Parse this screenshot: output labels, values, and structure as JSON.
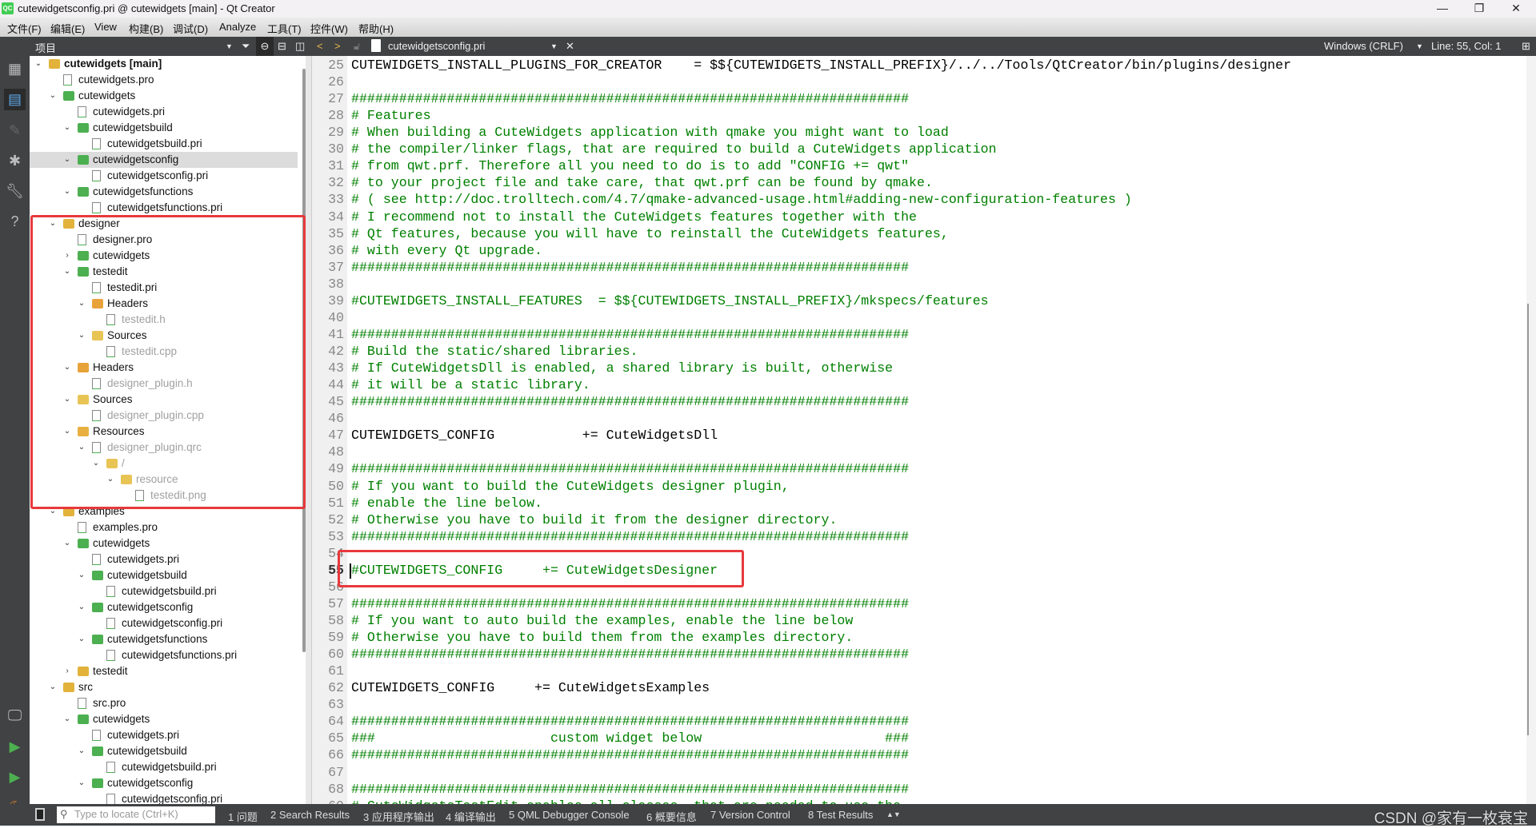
{
  "window": {
    "title": "cutewidgetsconfig.pri @ cutewidgets [main] - Qt Creator",
    "logo": "QC"
  },
  "menu": [
    "文件(F)",
    "编辑(E)",
    "View",
    "构建(B)",
    "调试(D)",
    "Analyze",
    "工具(T)",
    "控件(W)",
    "帮助(H)"
  ],
  "toolbar": {
    "panel_title": "项目",
    "file_name": "cutewidgetsconfig.pri",
    "line_ending": "Windows (CRLF)",
    "cursor_pos": "Line: 55, Col: 1"
  },
  "tree": [
    {
      "label": "cutewidgets [main]",
      "level": 0,
      "kind": "project",
      "exp": true,
      "bold": true
    },
    {
      "label": "cutewidgets.pro",
      "level": 1,
      "kind": "file"
    },
    {
      "label": "cutewidgets",
      "level": 1,
      "kind": "pfolder",
      "exp": true
    },
    {
      "label": "cutewidgets.pri",
      "level": 2,
      "kind": "file"
    },
    {
      "label": "cutewidgetsbuild",
      "level": 2,
      "kind": "pfolder",
      "exp": true
    },
    {
      "label": "cutewidgetsbuild.pri",
      "level": 3,
      "kind": "file"
    },
    {
      "label": "cutewidgetsconfig",
      "level": 2,
      "kind": "pfolder",
      "exp": true,
      "sel": true
    },
    {
      "label": "cutewidgetsconfig.pri",
      "level": 3,
      "kind": "file"
    },
    {
      "label": "cutewidgetsfunctions",
      "level": 2,
      "kind": "pfolder",
      "exp": true
    },
    {
      "label": "cutewidgetsfunctions.pri",
      "level": 3,
      "kind": "file"
    },
    {
      "label": "designer",
      "level": 1,
      "kind": "project",
      "exp": true
    },
    {
      "label": "designer.pro",
      "level": 2,
      "kind": "file"
    },
    {
      "label": "cutewidgets",
      "level": 2,
      "kind": "pfolder",
      "exp": false
    },
    {
      "label": "testedit",
      "level": 2,
      "kind": "pfolder",
      "exp": true
    },
    {
      "label": "testedit.pri",
      "level": 3,
      "kind": "file"
    },
    {
      "label": "Headers",
      "level": 3,
      "kind": "hfolder",
      "exp": true
    },
    {
      "label": "testedit.h",
      "level": 4,
      "kind": "hfile",
      "grey": true
    },
    {
      "label": "Sources",
      "level": 3,
      "kind": "cfolder",
      "exp": true
    },
    {
      "label": "testedit.cpp",
      "level": 4,
      "kind": "cfile",
      "grey": true
    },
    {
      "label": "Headers",
      "level": 2,
      "kind": "hfolder",
      "exp": true
    },
    {
      "label": "designer_plugin.h",
      "level": 3,
      "kind": "hfile",
      "grey": true
    },
    {
      "label": "Sources",
      "level": 2,
      "kind": "cfolder",
      "exp": true
    },
    {
      "label": "designer_plugin.cpp",
      "level": 3,
      "kind": "cfile",
      "grey": true
    },
    {
      "label": "Resources",
      "level": 2,
      "kind": "rfolder",
      "exp": true
    },
    {
      "label": "designer_plugin.qrc",
      "level": 3,
      "kind": "qrc",
      "exp": true,
      "grey": true
    },
    {
      "label": "/",
      "level": 4,
      "kind": "folder",
      "exp": true,
      "grey": true
    },
    {
      "label": "resource",
      "level": 5,
      "kind": "folder",
      "exp": true,
      "grey": true
    },
    {
      "label": "testedit.png",
      "level": 6,
      "kind": "img",
      "grey": true
    },
    {
      "label": "examples",
      "level": 1,
      "kind": "project",
      "exp": true
    },
    {
      "label": "examples.pro",
      "level": 2,
      "kind": "file"
    },
    {
      "label": "cutewidgets",
      "level": 2,
      "kind": "pfolder",
      "exp": true
    },
    {
      "label": "cutewidgets.pri",
      "level": 3,
      "kind": "file"
    },
    {
      "label": "cutewidgetsbuild",
      "level": 3,
      "kind": "pfolder",
      "exp": true
    },
    {
      "label": "cutewidgetsbuild.pri",
      "level": 4,
      "kind": "file"
    },
    {
      "label": "cutewidgetsconfig",
      "level": 3,
      "kind": "pfolder",
      "exp": true
    },
    {
      "label": "cutewidgetsconfig.pri",
      "level": 4,
      "kind": "file"
    },
    {
      "label": "cutewidgetsfunctions",
      "level": 3,
      "kind": "pfolder",
      "exp": true
    },
    {
      "label": "cutewidgetsfunctions.pri",
      "level": 4,
      "kind": "file"
    },
    {
      "label": "testedit",
      "level": 2,
      "kind": "project",
      "exp": false
    },
    {
      "label": "src",
      "level": 1,
      "kind": "srcproject",
      "exp": true
    },
    {
      "label": "src.pro",
      "level": 2,
      "kind": "file"
    },
    {
      "label": "cutewidgets",
      "level": 2,
      "kind": "pfolder",
      "exp": true
    },
    {
      "label": "cutewidgets.pri",
      "level": 3,
      "kind": "file"
    },
    {
      "label": "cutewidgetsbuild",
      "level": 3,
      "kind": "pfolder",
      "exp": true
    },
    {
      "label": "cutewidgetsbuild.pri",
      "level": 4,
      "kind": "file"
    },
    {
      "label": "cutewidgetsconfig",
      "level": 3,
      "kind": "pfolder",
      "exp": true
    },
    {
      "label": "cutewidgetsconfig.pri",
      "level": 4,
      "kind": "file"
    }
  ],
  "editor": {
    "first_line": 25,
    "current_line": 55,
    "lines": [
      "CUTEWIDGETS_INSTALL_PLUGINS_FOR_CREATOR    = $${CUTEWIDGETS_INSTALL_PREFIX}/../../Tools/QtCreator/bin/plugins/designer",
      "",
      "######################################################################",
      "# Features",
      "# When building a CuteWidgets application with qmake you might want to load",
      "# the compiler/linker flags, that are required to build a CuteWidgets application",
      "# from qwt.prf. Therefore all you need to do is to add \"CONFIG += qwt\"",
      "# to your project file and take care, that qwt.prf can be found by qmake.",
      "# ( see http://doc.trolltech.com/4.7/qmake-advanced-usage.html#adding-new-configuration-features )",
      "# I recommend not to install the CuteWidgets features together with the",
      "# Qt features, because you will have to reinstall the CuteWidgets features,",
      "# with every Qt upgrade.",
      "######################################################################",
      "",
      "#CUTEWIDGETS_INSTALL_FEATURES  = $${CUTEWIDGETS_INSTALL_PREFIX}/mkspecs/features",
      "",
      "######################################################################",
      "# Build the static/shared libraries.",
      "# If CuteWidgetsDll is enabled, a shared library is built, otherwise",
      "# it will be a static library.",
      "######################################################################",
      "",
      "CUTEWIDGETS_CONFIG           += CuteWidgetsDll",
      "",
      "######################################################################",
      "# If you want to build the CuteWidgets designer plugin,",
      "# enable the line below.",
      "# Otherwise you have to build it from the designer directory.",
      "######################################################################",
      "",
      "#CUTEWIDGETS_CONFIG     += CuteWidgetsDesigner",
      "",
      "######################################################################",
      "# If you want to auto build the examples, enable the line below",
      "# Otherwise you have to build them from the examples directory.",
      "######################################################################",
      "",
      "CUTEWIDGETS_CONFIG     += CuteWidgetsExamples",
      "",
      "######################################################################",
      "###                      custom widget below                       ###",
      "######################################################################",
      "",
      "######################################################################",
      "# CuteWidgetsTestEdit enables all classes, that are needed to use the"
    ]
  },
  "bottombar": {
    "locate_placeholder": "Type to locate (Ctrl+K)",
    "tabs": [
      "1 问题",
      "2 Search Results",
      "3 应用程序输出",
      "4 编译输出",
      "5 QML Debugger Console",
      "6 概要信息",
      "7 Version Control",
      "8 Test Results"
    ],
    "watermark": "CSDN @家有一枚衰宝"
  },
  "colors": {
    "comment": "#008000",
    "highlight_box": "#e8393c",
    "dark_panel": "#404244"
  }
}
